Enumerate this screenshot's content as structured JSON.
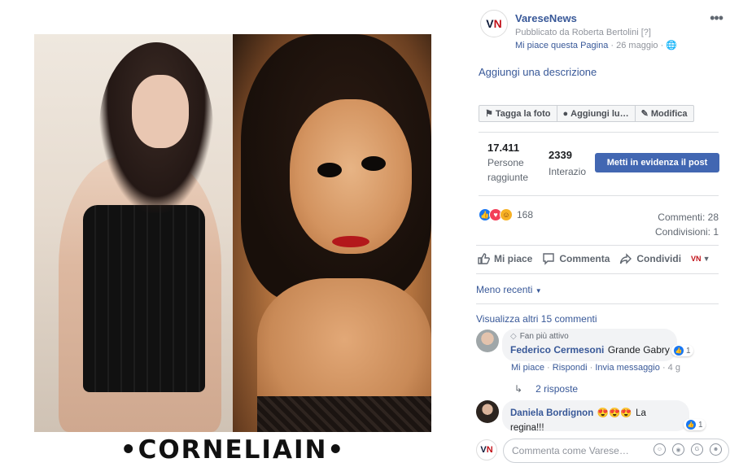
{
  "photo": {
    "caption": "•CORNELIAIN•"
  },
  "post": {
    "page_name": "VareseNews",
    "logo_text_a": "V",
    "logo_text_b": "N",
    "published_by": "Pubblicato da Roberta Bertolini [?]",
    "like_page": "Mi piace questa Pagina",
    "date": "· 26 maggio ·",
    "more": "•••",
    "add_description": "Aggiungi una descrizione"
  },
  "toolbar": {
    "tag": "Tagga la foto",
    "location": "Aggiungi lu…",
    "edit": "Modifica"
  },
  "stats": {
    "reach_value": "17.411",
    "reach_label_1": "Persone",
    "reach_label_2": "raggiunte",
    "interactions_value": "2339",
    "interactions_label": "Interazio",
    "boost_label": "Metti in evidenza il post"
  },
  "reactions": {
    "count": "168",
    "comments": "Commenti: 28",
    "shares": "Condivisioni: 1"
  },
  "actions": {
    "like": "Mi piace",
    "comment": "Commenta",
    "share": "Condividi",
    "page_switch": "VN"
  },
  "comments": {
    "sort": "Meno recenti",
    "view_more": "Visualizza altri 15 commenti",
    "items": [
      {
        "badge": "Fan più attivo",
        "name": "Federico Cermesoni",
        "text": "Grande Gabry",
        "reactions": "1",
        "like": "Mi piace",
        "reply": "Rispondi",
        "send": "Invia messaggio",
        "time": "4 g",
        "replies": "2 risposte"
      },
      {
        "name": "Daniela Bordignon",
        "emoji": "😍😍😍",
        "text": "La regina!!!",
        "reactions": "1"
      }
    ],
    "composer_placeholder": "Commenta come Varese…"
  },
  "colors": {
    "link": "#385898",
    "button": "#4267b2",
    "brand_red": "#c2121a"
  }
}
